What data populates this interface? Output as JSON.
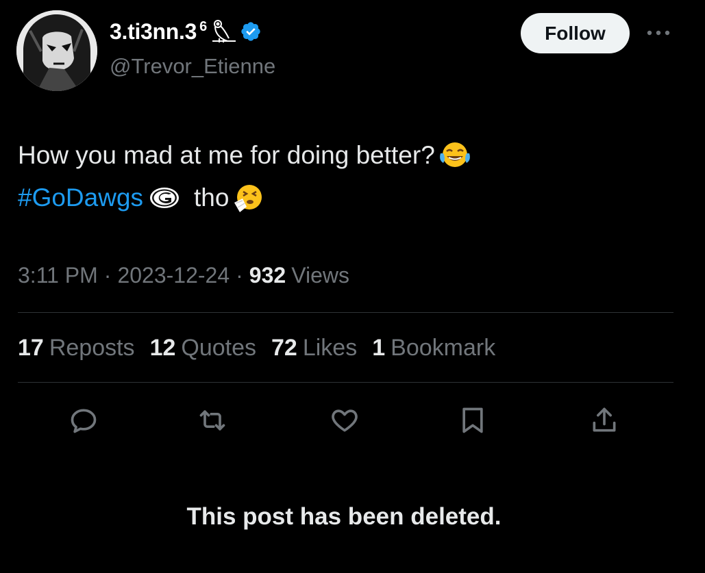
{
  "author": {
    "display_name": "3.ti3nn.3",
    "name_suffix": "6",
    "handle": "@Trevor_Etienne",
    "avatar_icon": "avatar-image",
    "badge_icons": [
      "owl-icon",
      "verified-icon"
    ],
    "verified_color": "#1d9bf0"
  },
  "header": {
    "follow_label": "Follow",
    "more_icon": "ellipsis-icon"
  },
  "tweet": {
    "line1_text": "How you mad at me for doing better?",
    "line1_emoji": "face-with-tears-of-joy-emoji",
    "hashtag": "#GoDawgs",
    "line2_logo": "georgia-g-logo",
    "line2_text": "tho",
    "line2_emoji": "sneezing-face-emoji"
  },
  "meta": {
    "time": "3:11 PM",
    "separator": "·",
    "date": "2023-12-24",
    "views_count": "932",
    "views_label": "Views"
  },
  "stats": [
    {
      "count": "17",
      "label": "Reposts"
    },
    {
      "count": "12",
      "label": "Quotes"
    },
    {
      "count": "72",
      "label": "Likes"
    },
    {
      "count": "1",
      "label": "Bookmark"
    }
  ],
  "actions": [
    "reply-icon",
    "repost-icon",
    "like-icon",
    "bookmark-icon",
    "share-icon"
  ],
  "notice": "This post has been deleted.",
  "colors": {
    "background": "#000000",
    "text_primary": "#e7e9ea",
    "text_secondary": "#71767b",
    "accent": "#1d9bf0",
    "divider": "#2f3336",
    "follow_bg": "#eff3f4"
  }
}
